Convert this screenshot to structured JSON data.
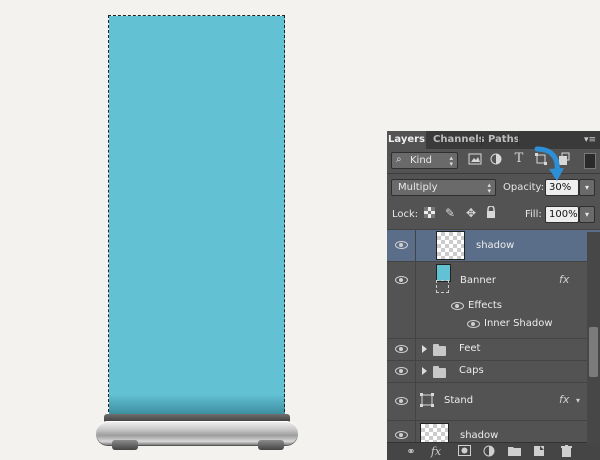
{
  "panel": {
    "tabs": [
      "Layers",
      "Channels",
      "Paths"
    ],
    "filter": {
      "kind_label": "Kind"
    },
    "blend_mode": "Multiply",
    "opacity_label": "Opacity:",
    "opacity_value": "30%",
    "lock_label": "Lock:",
    "fill_label": "Fill:",
    "fill_value": "100%",
    "layers": [
      {
        "name": "shadow",
        "selected": true
      },
      {
        "name": "Banner",
        "fx": "fx",
        "effects_label": "Effects",
        "effect_items": [
          "Inner Shadow"
        ]
      },
      {
        "name": "Feet"
      },
      {
        "name": "Caps"
      },
      {
        "name": "Stand",
        "fx": "fx"
      },
      {
        "name": "shadow"
      }
    ],
    "bottom_fx": "fx"
  },
  "colors": {
    "banner": "#62c2d4",
    "selected_layer": "#5a6e89",
    "pointer": "#2d8fd5"
  }
}
